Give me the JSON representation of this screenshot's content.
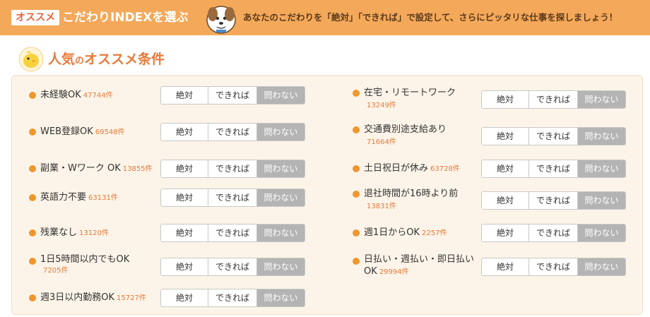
{
  "banner": {
    "badge": "オススメ",
    "title": "こだわりINDEXを選ぶ",
    "message": "あなたのこだわりを「絶対」「できれば」で設定して、さらにピッタリな仕事を探しましょう！",
    "bg_color": "#f4a85a"
  },
  "heading": {
    "part1": "人気",
    "part2": "の",
    "part3": "オススメ条件",
    "color": "#e8793a"
  },
  "options": [
    "絶対",
    "できれば",
    "問わない"
  ],
  "selected_option": "問わない",
  "left_items": [
    {
      "label": "未経験OK",
      "count": "47744件"
    },
    {
      "label": "WEB登録OK",
      "count": "69548件"
    },
    {
      "label": "副業・Wワーク OK",
      "count": "13855件"
    },
    {
      "label": "英語力不要",
      "count": "63131件"
    },
    {
      "label": "残業なし",
      "count": "13120件"
    },
    {
      "label": "1日5時間以内でもOK",
      "count": "7205件"
    },
    {
      "label": "週3日以内勤務OK",
      "count": "15727件"
    }
  ],
  "right_items": [
    {
      "label": "在宅・リモートワーク",
      "count": "13249件"
    },
    {
      "label": "交通費別途支給あり",
      "count": "71664件"
    },
    {
      "label": "土日祝日が休み",
      "count": "63728件"
    },
    {
      "label": "退社時間が16時より前",
      "count": "13831件"
    },
    {
      "label": "週1日からOK",
      "count": "2257件"
    },
    {
      "label_line1": "日払い・週払い・即日払い",
      "label_line2": "OK",
      "count": "29994件"
    }
  ]
}
